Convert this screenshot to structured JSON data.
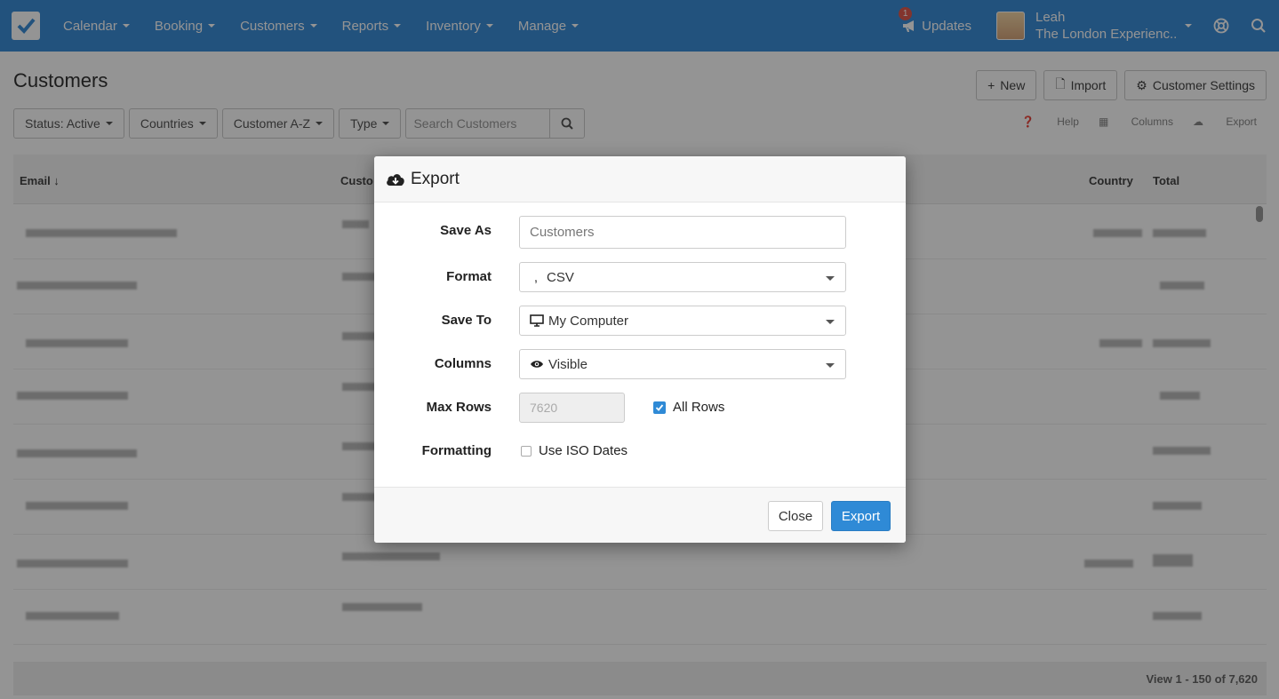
{
  "nav": {
    "items": [
      {
        "label": "Calendar"
      },
      {
        "label": "Booking"
      },
      {
        "label": "Customers"
      },
      {
        "label": "Reports"
      },
      {
        "label": "Inventory"
      },
      {
        "label": "Manage"
      }
    ],
    "updates_label": "Updates",
    "updates_count": "1",
    "user_name": "Leah",
    "user_company": "The London Experienc...",
    "brand_color": "#3c8dd7"
  },
  "page": {
    "title": "Customers",
    "new_label": "New",
    "import_label": "Import",
    "settings_label": "Customer Settings",
    "filters": {
      "status": "Status: Active",
      "countries": "Countries",
      "sort": "Customer A-Z",
      "type": "Type"
    },
    "search_placeholder": "Search Customers",
    "tools": {
      "help": "Help",
      "columns": "Columns",
      "export": "Export"
    },
    "columns": {
      "email": "Email ↓",
      "customer": "Custo",
      "country": "Country",
      "total": "Total"
    },
    "footer": "View 1 - 150 of 7,620"
  },
  "modal": {
    "title": "Export",
    "save_as_label": "Save As",
    "save_as_value": "Customers",
    "format_label": "Format",
    "format_value": "CSV",
    "format_icon": ",",
    "save_to_label": "Save To",
    "save_to_value": "My Computer",
    "columns_label": "Columns",
    "columns_value": "Visible",
    "max_rows_label": "Max Rows",
    "max_rows_value": "7620",
    "all_rows_label": "All Rows",
    "all_rows_checked": true,
    "formatting_label": "Formatting",
    "iso_label": "Use ISO Dates",
    "iso_checked": false,
    "close_label": "Close",
    "export_label": "Export",
    "accent_color": "#2f8ad6"
  }
}
